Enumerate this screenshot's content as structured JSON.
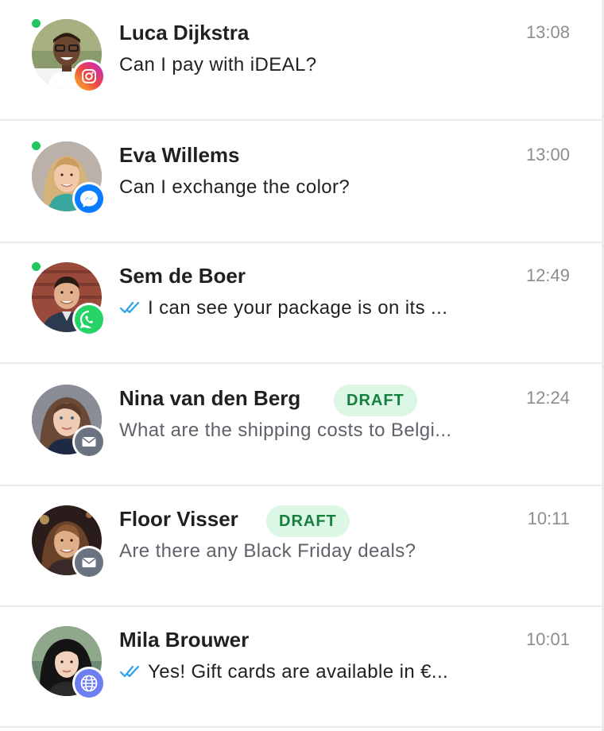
{
  "conversations": [
    {
      "name": "Luca Dijkstra",
      "time": "13:08",
      "preview": "Can I pay with iDEAL?",
      "channel": "instagram-icon",
      "online": true,
      "draft": "",
      "read_receipt": false
    },
    {
      "name": "Eva Willems",
      "time": "13:00",
      "preview": "Can I exchange the color?",
      "channel": "messenger-icon",
      "online": true,
      "draft": "",
      "read_receipt": false
    },
    {
      "name": "Sem de Boer",
      "time": "12:49",
      "preview": "I can see your package is on its ...",
      "channel": "whatsapp-icon",
      "online": true,
      "draft": "",
      "read_receipt": true
    },
    {
      "name": "Nina van den Berg",
      "time": "12:24",
      "preview": "What are the shipping costs to Belgi...",
      "channel": "email-icon",
      "online": false,
      "draft": "DRAFT",
      "read_receipt": false
    },
    {
      "name": "Floor Visser",
      "time": "10:11",
      "preview": "Are there any Black Friday deals?",
      "channel": "email-icon",
      "online": false,
      "draft": "DRAFT",
      "read_receipt": false
    },
    {
      "name": "Mila Brouwer",
      "time": "10:01",
      "preview": "Yes! Gift cards are available in €...",
      "channel": "web-chat-icon",
      "online": false,
      "draft": "",
      "read_receipt": true
    }
  ],
  "colors": {
    "online": "#22c55e",
    "draft_bg": "#dcf7e6",
    "draft_text": "#15803d",
    "read_receipt": "#2aa3e6",
    "instagram": "#e1306c",
    "messenger": "#0a7cff",
    "whatsapp": "#25d366",
    "email": "#6b7280",
    "web_chat": "#6d7ff0"
  }
}
